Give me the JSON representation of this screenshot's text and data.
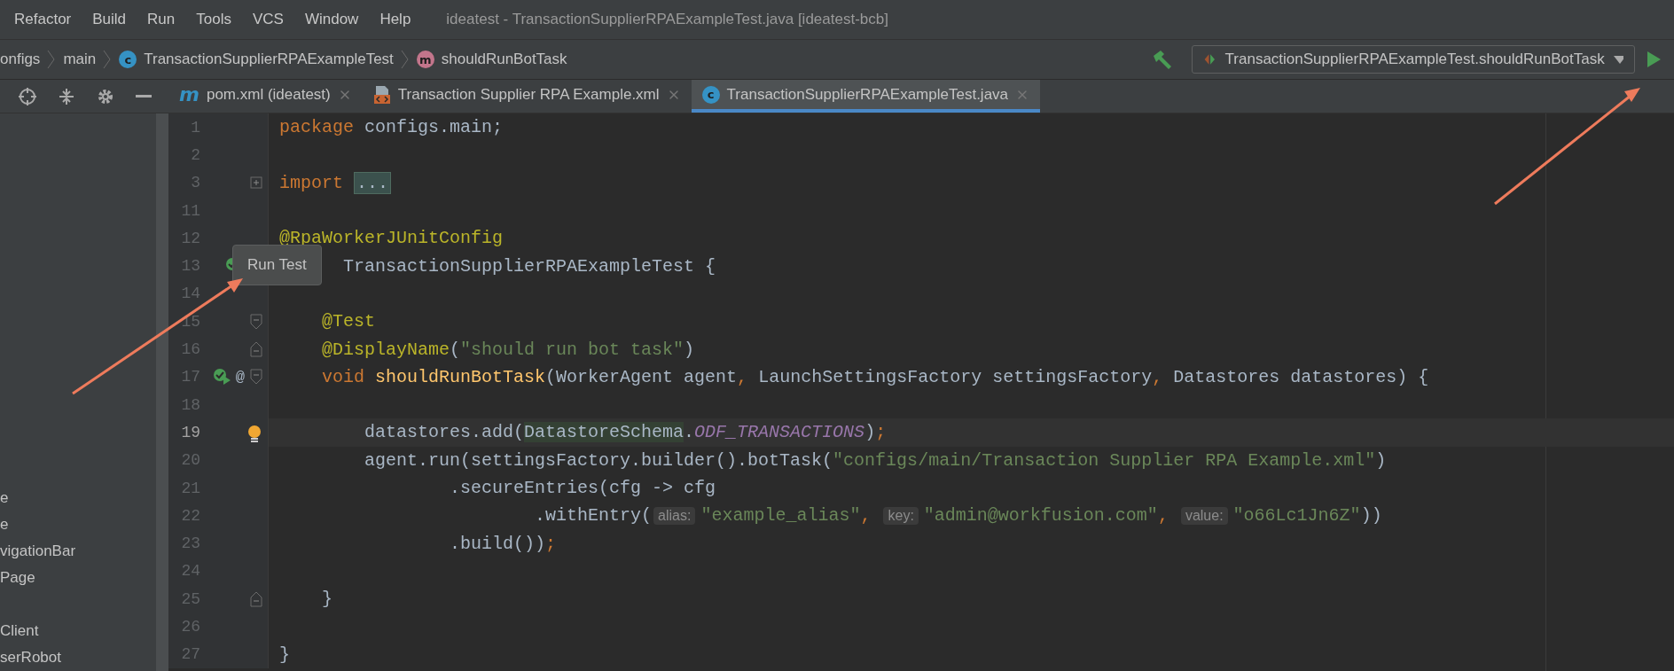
{
  "menu": [
    {
      "label": "Refactor"
    },
    {
      "label": "Build"
    },
    {
      "label": "Run"
    },
    {
      "label": "Tools"
    },
    {
      "label": "VCS"
    },
    {
      "label": "Window"
    },
    {
      "label": "Help"
    }
  ],
  "window_title": "ideatest - TransactionSupplierRPAExampleTest.java [ideatest-bcb]",
  "breadcrumbs": [
    {
      "label": "onfigs",
      "kind": "text"
    },
    {
      "label": "main",
      "kind": "text"
    },
    {
      "label": "TransactionSupplierRPAExampleTest",
      "kind": "class",
      "badge": "c"
    },
    {
      "label": "shouldRunBotTask",
      "kind": "method",
      "badge": "m"
    }
  ],
  "run_config": {
    "label": "TransactionSupplierRPAExampleTest.shouldRunBotTask"
  },
  "tabs": [
    {
      "label": "pom.xml (ideatest)",
      "kind": "maven",
      "badge": "m",
      "selected": false
    },
    {
      "label": "Transaction Supplier RPA Example.xml",
      "kind": "xml",
      "selected": false
    },
    {
      "label": "TransactionSupplierRPAExampleTest.java",
      "kind": "class",
      "badge": "c",
      "selected": true
    }
  ],
  "sidebar": {
    "items": [
      "e",
      "e",
      "vigationBar",
      "Page",
      "Client",
      "serRobot"
    ]
  },
  "editor": {
    "lines": [
      {
        "number": "1",
        "current": false,
        "tokens": [
          {
            "kind": "keyword",
            "text": "package"
          },
          {
            "kind": "plain",
            "text": " configs.main;"
          }
        ]
      },
      {
        "number": "2",
        "current": false
      },
      {
        "number": "3",
        "current": false,
        "gutter": [
          {
            "kind": "fold_collapsed"
          }
        ],
        "tokens": [
          {
            "kind": "keyword",
            "text": "import"
          },
          {
            "kind": "folded",
            "text": "..."
          }
        ]
      },
      {
        "number": "11",
        "current": false
      },
      {
        "number": "12",
        "current": false,
        "tokens": [
          {
            "kind": "annotation",
            "text": "@RpaWorkerJUnitConfig"
          }
        ]
      },
      {
        "number": "13",
        "current": false,
        "tooltip": "Run Test",
        "gutter": [
          {
            "kind": "run"
          }
        ],
        "tokens": [
          {
            "kind": "plain",
            "text": "TransactionSupplierRPAExampleTest {"
          }
        ]
      },
      {
        "number": "14",
        "current": false
      },
      {
        "number": "15",
        "current": false,
        "gutter": [
          {
            "kind": "fold_start"
          }
        ],
        "tokens": [
          {
            "kind": "annotation",
            "text": "    @Test"
          }
        ]
      },
      {
        "number": "16",
        "current": false,
        "gutter": [
          {
            "kind": "fold_end"
          }
        ],
        "tokens": [
          {
            "kind": "annotation",
            "text": "    @DisplayName"
          },
          {
            "kind": "plain",
            "text": "("
          },
          {
            "kind": "string",
            "text": "\"should run bot task\""
          },
          {
            "kind": "plain",
            "text": ")"
          }
        ]
      },
      {
        "number": "17",
        "current": false,
        "gutter": [
          {
            "kind": "run"
          },
          {
            "kind": "text",
            "text": "@"
          },
          {
            "kind": "fold_start"
          }
        ],
        "tokens": [
          {
            "kind": "keyword",
            "text": "    void "
          },
          {
            "kind": "method",
            "text": "shouldRunBotTask"
          },
          {
            "kind": "plain",
            "text": "(WorkerAgent agent"
          },
          {
            "kind": "keyword",
            "text": ", "
          },
          {
            "kind": "plain",
            "text": "LaunchSettingsFactory settingsFactory"
          },
          {
            "kind": "keyword",
            "text": ", "
          },
          {
            "kind": "plain",
            "text": "Datastores datastores) {"
          }
        ]
      },
      {
        "number": "18",
        "current": false
      },
      {
        "number": "19",
        "current": true,
        "bulb": true,
        "tokens": [
          {
            "kind": "plain",
            "text": "        datastores.add("
          },
          {
            "kind": "highlight",
            "text": "DatastoreSchema"
          },
          {
            "kind": "plain",
            "text": "."
          },
          {
            "kind": "field",
            "text": "ODF_TRANSACTIONS"
          },
          {
            "kind": "plain",
            "text": ")"
          },
          {
            "kind": "keyword",
            "text": ";"
          }
        ]
      },
      {
        "number": "20",
        "current": false,
        "tokens": [
          {
            "kind": "plain",
            "text": "        agent.run(settingsFactory.builder().botTask("
          },
          {
            "kind": "string",
            "text": "\"configs/main/Transaction Supplier RPA Example.xml\""
          },
          {
            "kind": "plain",
            "text": ")"
          }
        ]
      },
      {
        "number": "21",
        "current": false,
        "tokens": [
          {
            "kind": "plain",
            "text": "                .secureEntries(cfg -> cfg"
          }
        ]
      },
      {
        "number": "22",
        "current": false,
        "tokens": [
          {
            "kind": "plain",
            "text": "                        .withEntry("
          },
          {
            "kind": "hint",
            "text": "alias:"
          },
          {
            "kind": "string",
            "text": "\"example_alias\""
          },
          {
            "kind": "keyword",
            "text": ", "
          },
          {
            "kind": "hint",
            "text": "key:"
          },
          {
            "kind": "string",
            "text": "\"admin@workfusion.com\""
          },
          {
            "kind": "keyword",
            "text": ", "
          },
          {
            "kind": "hint",
            "text": "value:"
          },
          {
            "kind": "string",
            "text": "\"o66Lc1Jn6Z\""
          },
          {
            "kind": "plain",
            "text": "))"
          }
        ]
      },
      {
        "number": "23",
        "current": false,
        "tokens": [
          {
            "kind": "plain",
            "text": "                .build())"
          },
          {
            "kind": "keyword",
            "text": ";"
          }
        ]
      },
      {
        "number": "24",
        "current": false
      },
      {
        "number": "25",
        "current": false,
        "gutter": [
          {
            "kind": "fold_end"
          }
        ],
        "tokens": [
          {
            "kind": "plain",
            "text": "    }"
          }
        ]
      },
      {
        "number": "26",
        "current": false
      },
      {
        "number": "27",
        "current": false,
        "tokens": [
          {
            "kind": "plain",
            "text": "}"
          }
        ]
      }
    ]
  }
}
